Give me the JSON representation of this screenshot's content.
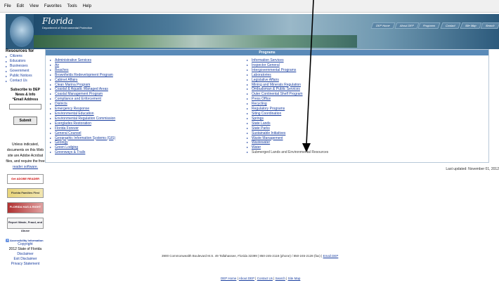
{
  "browser_menu": [
    "File",
    "Edit",
    "View",
    "Favorites",
    "Tools",
    "Help"
  ],
  "header": {
    "logo_name": "Florida",
    "logo_subtitle": "Department of Environmental Protection",
    "topnav": [
      "DEP Home",
      "About DEP",
      "Programs",
      "Contact",
      "Site Map",
      "Search"
    ]
  },
  "sidebar": {
    "resources_title": "Resources for",
    "resources": [
      "Citizens",
      "Educators",
      "Businesses",
      "Government",
      "Public Notices",
      "Contact Us"
    ],
    "subscribe_title": "Subscribe to DEP News & Info",
    "email_label": "*Email Address",
    "submit_label": "Submit",
    "notice_text": "Unless indicated, documents on this Web site are Adobe Acrobat files, and require the free",
    "notice_link": "reader software.",
    "banners": {
      "adobe": "Get ADOBE READER",
      "fff": "Florida Families First",
      "right_to_know": "FLORIDA HAS A RIGHT TO KNOW",
      "report": "Report Waste, Fraud, and Abuse"
    },
    "accessibility": "Accessibility Information",
    "copyright_link": "Copyright",
    "copyright_text": "2012 State of Florida",
    "disclaimer": "Disclaimer",
    "exit_disclaimer": "Exit Disclaimer",
    "privacy": "Privacy Statement"
  },
  "programs": {
    "heading": "Programs",
    "left": [
      "Administrative Services",
      "Air",
      "Beaches",
      "Brownfields Redevelopment Program",
      "Cabinet Affairs",
      "Clean Marina Program",
      "Coastal & Aquatic Managed Areas",
      "Coastal Management Program",
      "Compliance and Enforcement",
      "Districts",
      "Emergency Response",
      "Environmental Education",
      "Environmental Regulation Commission",
      "Everglades Restoration",
      "Florida Forever",
      "General Counsel",
      "Geographic Information Systems (GIS)",
      "Geology",
      "Green Lodging",
      "Greenways & Trails"
    ],
    "right": [
      "Information Services",
      "Inspector General",
      "Intergovernmental Programs",
      "Laboratories",
      "Legislative Affairs",
      "Mining and Minerals Regulation",
      "Ombudsman & Public Services",
      "Outer Continental Shelf Program",
      "Press Office",
      "Recycling",
      "Regulatory Programs",
      "Siting Coordination",
      "Springs",
      "State Lands",
      "State Parks",
      "Sustainable Initiatives",
      "Waste Management",
      "Wastewater",
      "Water",
      "Submerged Lands and Environmental Resources"
    ]
  },
  "last_updated": "Last updated: November 01, 2012",
  "footer": {
    "address": "3900 Commonwealth Boulevard M.S. 49   Tallahassee, Florida 32399 | 850-245-2118 (phone) / 850-245-2128 (fax) |",
    "email_link": "Email DEP",
    "links": [
      "DEP Home",
      "About DEP",
      "Contact Us",
      "Search",
      "Site Map"
    ]
  },
  "colors": {
    "link": "#1a3fa0",
    "panel_header": "#5a8ab8",
    "header_bg": "#2c5a7c",
    "annotation_arrow": "#000000"
  }
}
